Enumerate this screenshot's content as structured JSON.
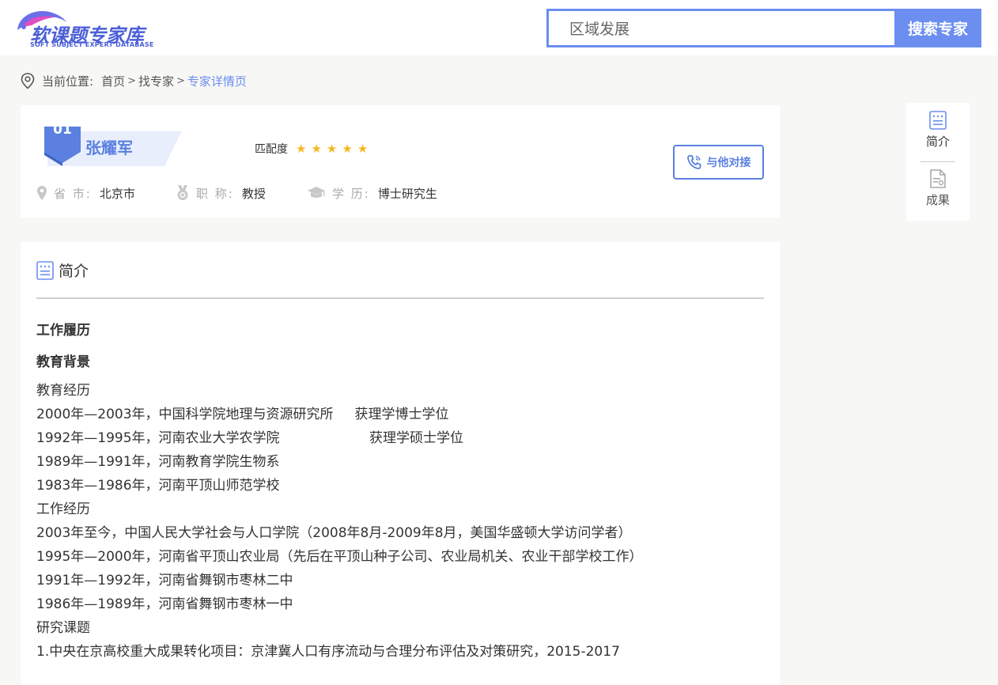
{
  "header": {
    "logo_title": "软课题专家库",
    "logo_subtitle": "SOFT SUBJECT EXPERT DATABASE",
    "search_value": "区域发展",
    "search_button": "搜索专家"
  },
  "breadcrumb": {
    "prefix": "当前位置:",
    "items": [
      "首页",
      "找专家",
      "专家详情页"
    ],
    "separator": ">"
  },
  "expert": {
    "rank": "01",
    "name": "张耀军",
    "match_label": "匹配度",
    "match_stars": 5,
    "contact_button": "与他对接",
    "province_label": "省 市:",
    "province": "北京市",
    "title_label": "职 称:",
    "title": "教授",
    "degree_label": "学 历:",
    "degree": "博士研究生"
  },
  "intro": {
    "heading": "简介",
    "work_history": "工作履历",
    "education_bg": "教育背景",
    "lines": [
      "教育经历",
      "2000年—2003年，中国科学院地理与资源研究所     获理学博士学位",
      "1992年—1995年，河南农业大学农学院                     获理学硕士学位",
      "1989年—1991年，河南教育学院生物系",
      "1983年—1986年，河南平顶山师范学校",
      "工作经历",
      "2003年至今，中国人民大学社会与人口学院（2008年8月-2009年8月，美国华盛顿大学访问学者）",
      "1995年—2000年，河南省平顶山农业局（先后在平顶山种子公司、农业局机关、农业干部学校工作）",
      "1991年—1992年，河南省舞钢市枣林二中",
      "1986年—1989年，河南省舞钢市枣林一中",
      "研究课题",
      "1.中央在京高校重大成果转化项目：京津冀人口有序流动与合理分布评估及对策研究，2015-2017"
    ]
  },
  "sidenav": {
    "items": [
      "简介",
      "成果"
    ]
  },
  "colors": {
    "accent": "#6b8ef0",
    "accent_dark": "#5b80e0",
    "star": "#f5b820",
    "background": "#f7f7f5"
  }
}
